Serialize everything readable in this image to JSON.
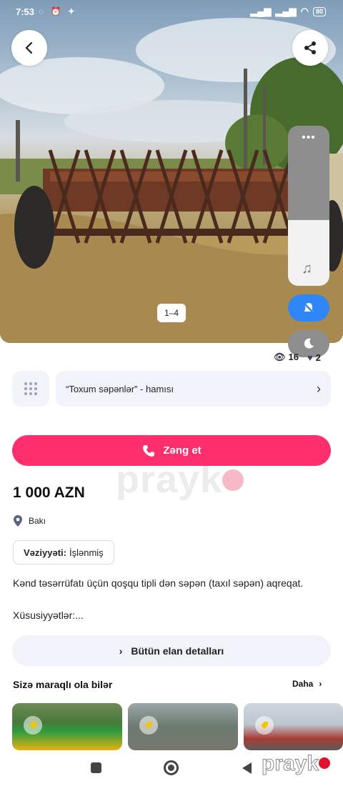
{
  "status_bar": {
    "time": "7:53",
    "battery": "80"
  },
  "gallery": {
    "counter": "1–4"
  },
  "stats": {
    "views": "16",
    "favorites": "2"
  },
  "category": {
    "label": "“Toxum səpənlər” - hamısı"
  },
  "call_button": {
    "label": "Zəng et"
  },
  "watermark": {
    "text": "prayk"
  },
  "listing": {
    "price": "1 000 AZN",
    "location": "Bakı",
    "condition_label": "Vəziyyəti:",
    "condition_value": "İşlənmiş",
    "description": "Kənd təsərrüfatı üçün qoşqu tipli dən səpən (taxıl səpən) aqreqat.",
    "features": "Xüsusiyyətlər:..."
  },
  "details_button": {
    "label": "Bütün elan detalları"
  },
  "recommended": {
    "title": "Sizə maraqlı ola bilər",
    "more": "Daha"
  },
  "brand_logo": {
    "text": "prayk"
  },
  "colors": {
    "accent": "#ff2f6d",
    "blue_pill": "#2f86f6",
    "surface": "#f2f3fa"
  }
}
